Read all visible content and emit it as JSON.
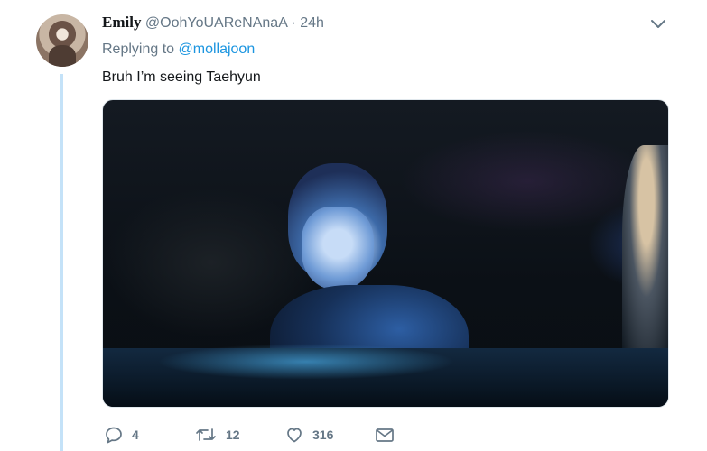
{
  "tweet": {
    "display_name": "Emily",
    "handle": "@OohYoUAReNAnaA",
    "separator": "·",
    "time": "24h",
    "replying_prefix": "Replying to",
    "replying_to": "@mollajoon",
    "text": "Bruh I’m seeing Taehyun"
  },
  "media": {
    "watermark": "",
    "accent_color": "#4fb7ff"
  },
  "actions": {
    "reply_count": "4",
    "retweet_count": "12",
    "like_count": "316"
  },
  "colors": {
    "thread_line": "#c4e2f8",
    "link": "#1b95e0",
    "secondary_text": "#657786"
  },
  "icons": [
    "chevron-down-icon",
    "reply-icon",
    "retweet-icon",
    "heart-icon",
    "envelope-icon"
  ]
}
